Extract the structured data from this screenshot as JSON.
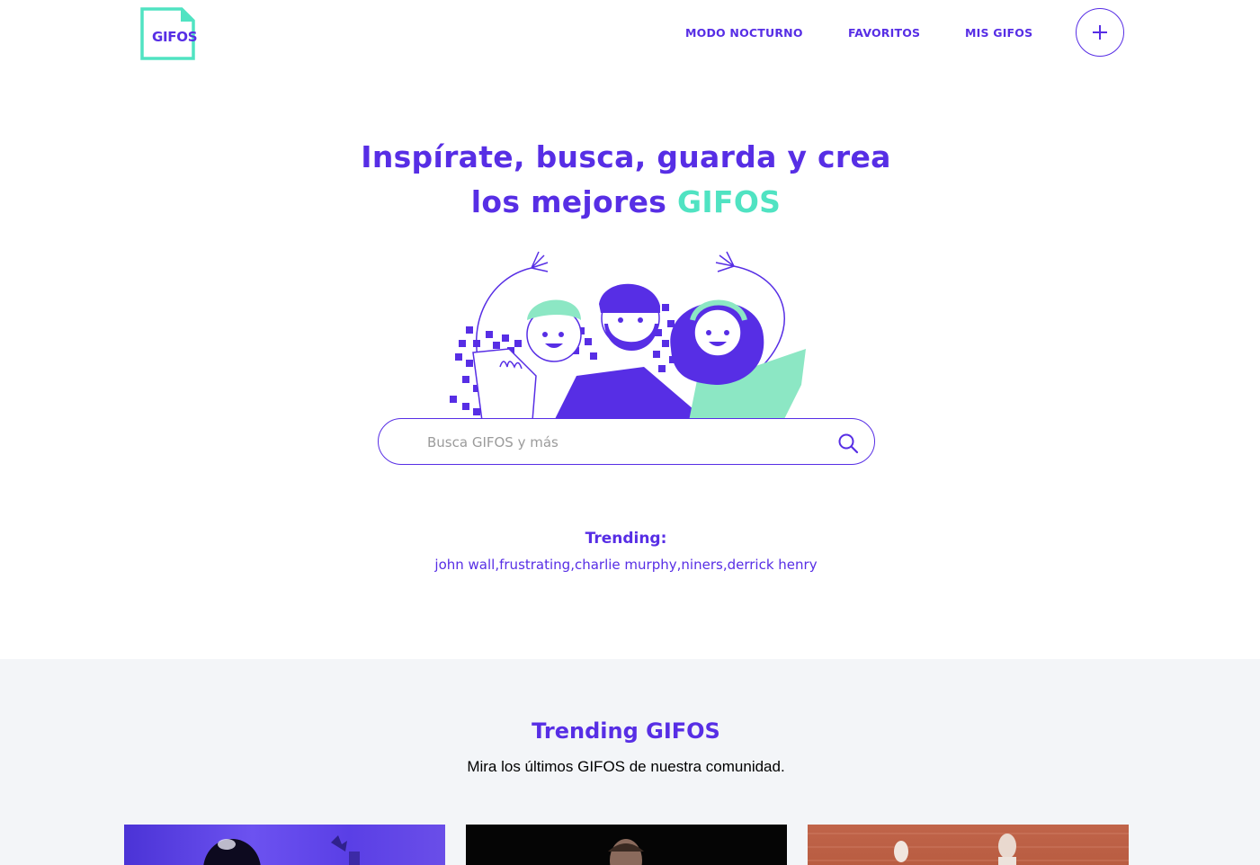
{
  "header": {
    "logo_text": "GIFOS",
    "nav": {
      "night_mode": "MODO NOCTURNO",
      "favorites": "FAVORITOS",
      "my_gifos": "MIS GIFOS"
    },
    "create_icon": "plus-icon"
  },
  "hero": {
    "title_line1": "Inspírate, busca, guarda y crea",
    "title_line2_prefix": "los mejores ",
    "title_line2_accent": "GIFOS"
  },
  "search": {
    "placeholder": "Busca GIFOS y más",
    "value": "",
    "icon": "search-icon"
  },
  "trending": {
    "label": "Trending:",
    "terms": [
      "john wall",
      "frustrating",
      "charlie murphy",
      "niners",
      "derrick henry"
    ],
    "separators": [
      ",",
      ",",
      ",",
      ","
    ]
  },
  "trending_section": {
    "title": "Trending GIFOS",
    "subtitle": "Mira los últimos GIFOS de nuestra comunidad."
  },
  "colors": {
    "primary": "#572EE5",
    "accent": "#50E3C2",
    "section_bg": "#F3F5F8",
    "text_dark": "#000000"
  }
}
